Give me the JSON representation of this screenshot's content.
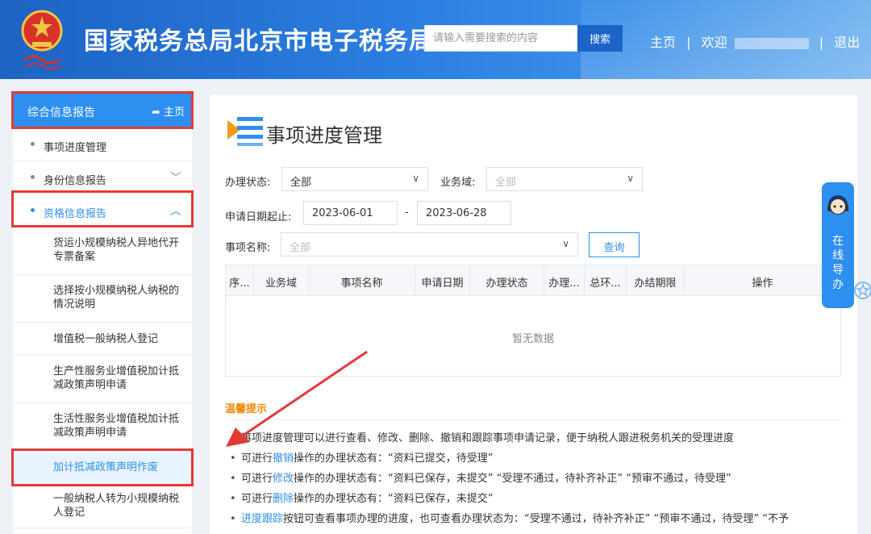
{
  "header": {
    "title": "国家税务总局北京市电子税务局",
    "search_placeholder": "请输入需要搜索的内容",
    "search_button": "搜索",
    "nav_home": "主页",
    "nav_sep": "|",
    "nav_welcome": "欢迎",
    "nav_logout": "退出",
    "brand_color": "#2b7de0"
  },
  "sidebar": {
    "head_label": "综合信息报告",
    "head_home": "主页",
    "items": [
      {
        "label": "事项进度管理"
      },
      {
        "label": "身份信息报告"
      },
      {
        "label": "资格信息报告"
      }
    ],
    "sub_items": [
      {
        "label": "货运小规模纳税人异地代开专票备案"
      },
      {
        "label": "选择按小规模纳税人纳税的情况说明"
      },
      {
        "label": "增值税一般纳税人登记"
      },
      {
        "label": "生产性服务业增值税加计抵减政策声明申请"
      },
      {
        "label": "生活性服务业增值税加计抵减政策声明申请"
      },
      {
        "label": "加计抵减政策声明作废"
      },
      {
        "label": "一般纳税人转为小规模纳税人登记"
      }
    ]
  },
  "main": {
    "title": "事项进度管理",
    "status_label": "办理状态:",
    "status_value": "全部",
    "domain_label": "业务域:",
    "domain_placeholder": "全部",
    "date_label": "申请日期起止:",
    "date_start": "2023-06-01",
    "date_sep": "-",
    "date_end": "2023-06-28",
    "item_label": "事项名称:",
    "item_placeholder": "全部",
    "query_button": "查询",
    "table_headers": [
      "序...",
      "业务域",
      "事项名称",
      "申请日期",
      "办理状态",
      "办理...",
      "总环...",
      "办结期限",
      "操作"
    ],
    "empty_text": "暂无数据",
    "tips_title": "温馨提示",
    "tips": [
      {
        "pre": "事项进度管理可以进行查看、修改、删除、撤销和跟踪事项申请记录，便于纳税人跟进税务机关的受理进度",
        "link": "",
        "post": ""
      },
      {
        "pre": "可进行",
        "link": "撤销",
        "post": "操作的办理状态有：“资料已提交，待受理”"
      },
      {
        "pre": "可进行",
        "link": "修改",
        "post": "操作的办理状态有：“资料已保存，未提交”  “受理不通过，待补齐补正”  “预审不通过，待受理”"
      },
      {
        "pre": "可进行",
        "link": "删除",
        "post": "操作的办理状态有：“资料已保存，未提交”"
      },
      {
        "pre": "",
        "link": "进度跟踪",
        "post": "按钮可查看事项办理的进度，也可查看办理状态为：“受理不通过，待补齐补正”  “预审不通过，待受理”  “不予"
      }
    ]
  },
  "guide": {
    "lines": [
      "在",
      "线",
      "导",
      "办"
    ]
  }
}
